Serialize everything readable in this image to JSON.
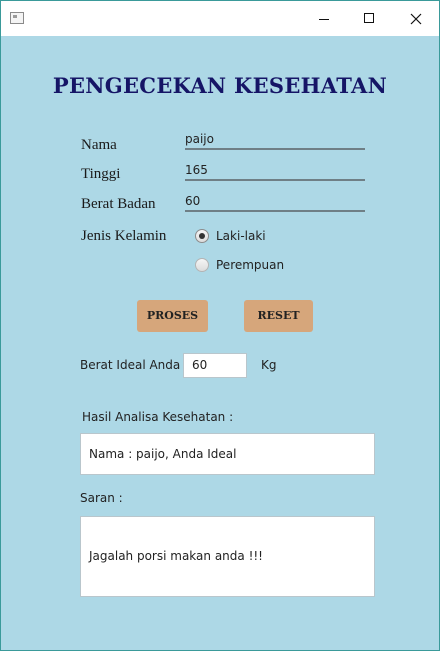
{
  "window": {
    "title": ""
  },
  "form": {
    "title": "PENGECEKAN KESEHATAN",
    "nama_label": "Nama",
    "nama_value": "paijo",
    "tinggi_label": "Tinggi",
    "tinggi_value": "165",
    "berat_label": "Berat Badan",
    "berat_value": "60",
    "gender_label": "Jenis Kelamin",
    "gender_options": [
      "Laki-laki",
      "Perempuan"
    ],
    "gender_selected": "Laki-laki"
  },
  "buttons": {
    "proses": "PROSES",
    "reset": "RESET"
  },
  "result": {
    "ideal_label": "Berat Ideal Anda",
    "ideal_value": "60",
    "ideal_unit": "Kg",
    "analysis_label": "Hasil Analisa Kesehatan :",
    "analysis_text": "Nama : paijo, Anda Ideal",
    "saran_label": "Saran :",
    "saran_text": "Jagalah porsi makan anda !!!"
  },
  "colors": {
    "background": "#add8e6",
    "title": "#151566",
    "button": "#d6a67b"
  },
  "icons": [
    "app-window-icon",
    "minimize-icon",
    "maximize-icon",
    "close-icon"
  ]
}
